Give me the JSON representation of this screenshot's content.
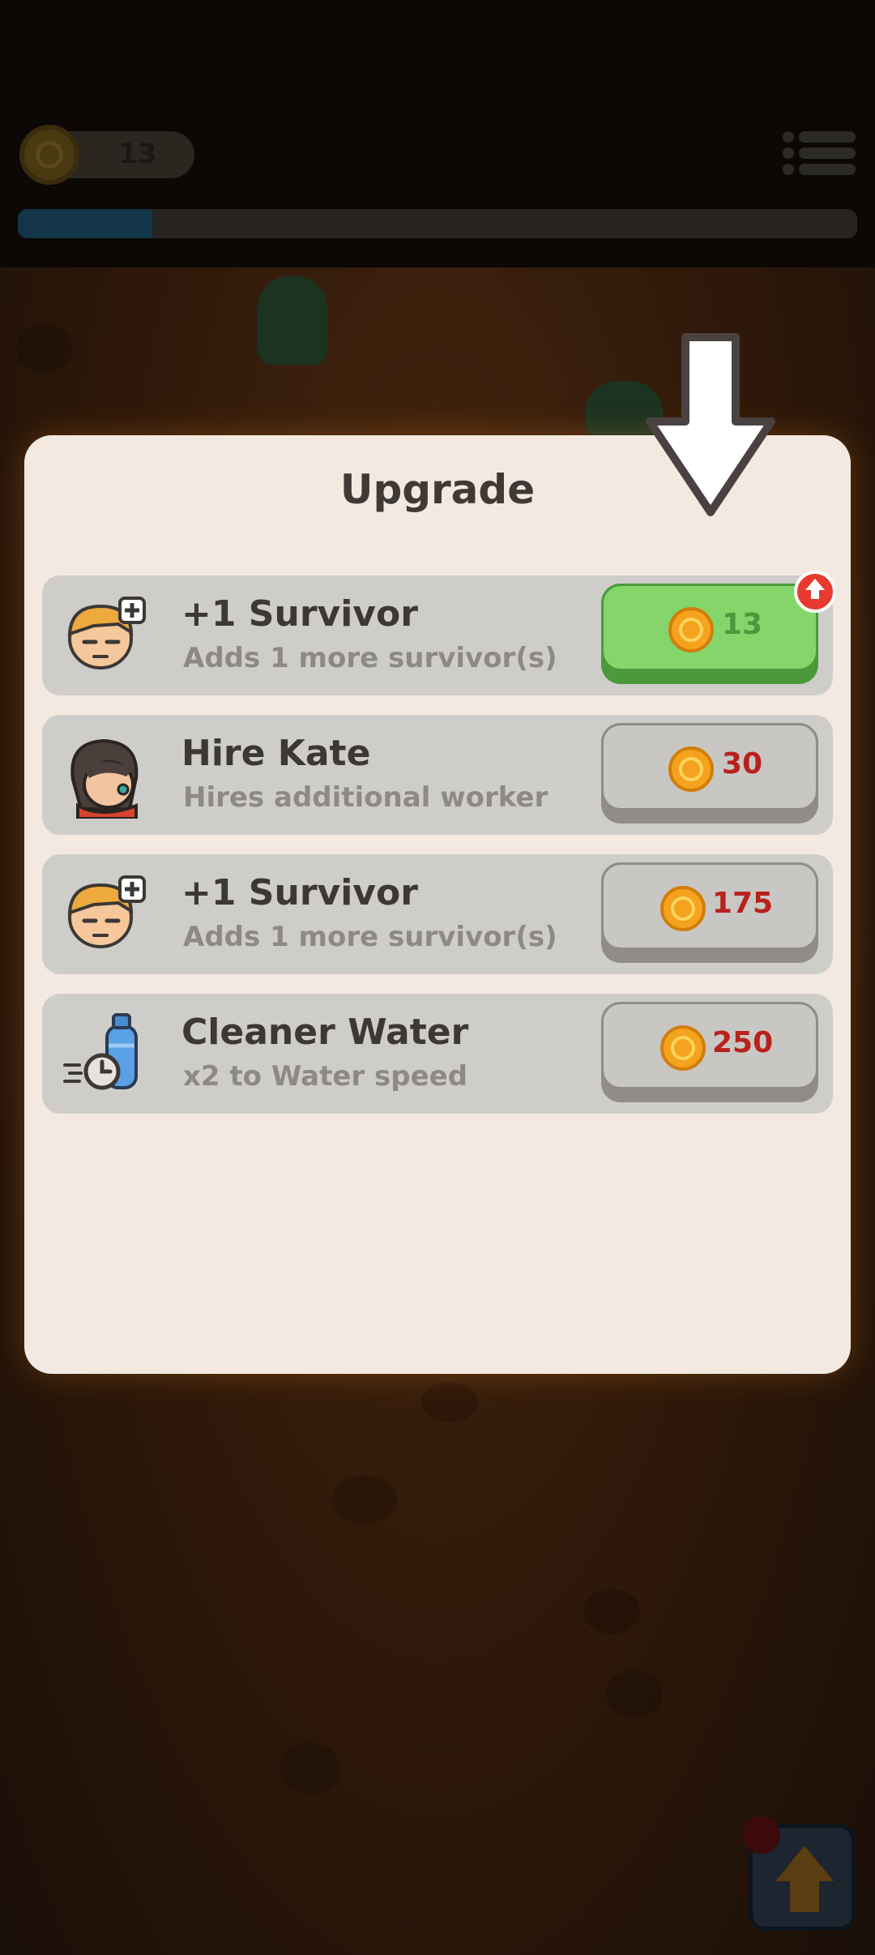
{
  "hud": {
    "coins": "13",
    "level_progress": 0.16
  },
  "modal": {
    "title": "Upgrade"
  },
  "upgrades": [
    {
      "name": "+1 Survivor",
      "description": "Adds 1 more survivor(s)",
      "price": "13",
      "affordable": true,
      "icon": "survivor-plus-icon"
    },
    {
      "name": "Hire Kate",
      "description": "Hires additional worker",
      "price": "30",
      "affordable": false,
      "icon": "kate-portrait-icon"
    },
    {
      "name": "+1 Survivor",
      "description": "Adds 1 more survivor(s)",
      "price": "175",
      "affordable": false,
      "icon": "survivor-plus-icon"
    },
    {
      "name": "Cleaner Water",
      "description": "x2 to Water speed",
      "price": "250",
      "affordable": false,
      "icon": "water-bottle-speed-icon"
    }
  ],
  "colors": {
    "affordable_button": "#84d66b",
    "locked_button": "#c9c7c4",
    "price_locked_text": "#b8211c",
    "price_affordable_text": "#4a9a3c",
    "modal_bg": "#f3e9e0"
  }
}
